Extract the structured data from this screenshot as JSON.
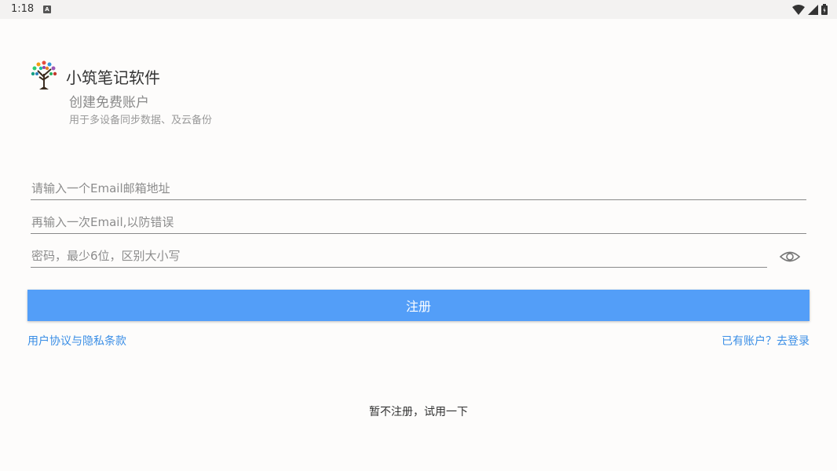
{
  "status_bar": {
    "time": "1:18",
    "notification_icon": "A",
    "icons": [
      "wifi-icon",
      "signal-icon",
      "battery-icon"
    ]
  },
  "header": {
    "app_name": "小筑笔记软件",
    "title": "创建免费账户",
    "subtitle": "用于多设备同步数据、及云备份"
  },
  "form": {
    "email_placeholder": "请输入一个Email邮箱地址",
    "email_confirm_placeholder": "再输入一次Email,以防错误",
    "password_placeholder": "密码，最少6位，区别大小写"
  },
  "actions": {
    "register_label": "注册",
    "agreement_link": "用户协议与隐私条款",
    "login_link": "已有账户？去登录",
    "try_link": "暂不注册，试用一下"
  },
  "colors": {
    "accent": "#539ef8",
    "link": "#3a8ee6"
  }
}
